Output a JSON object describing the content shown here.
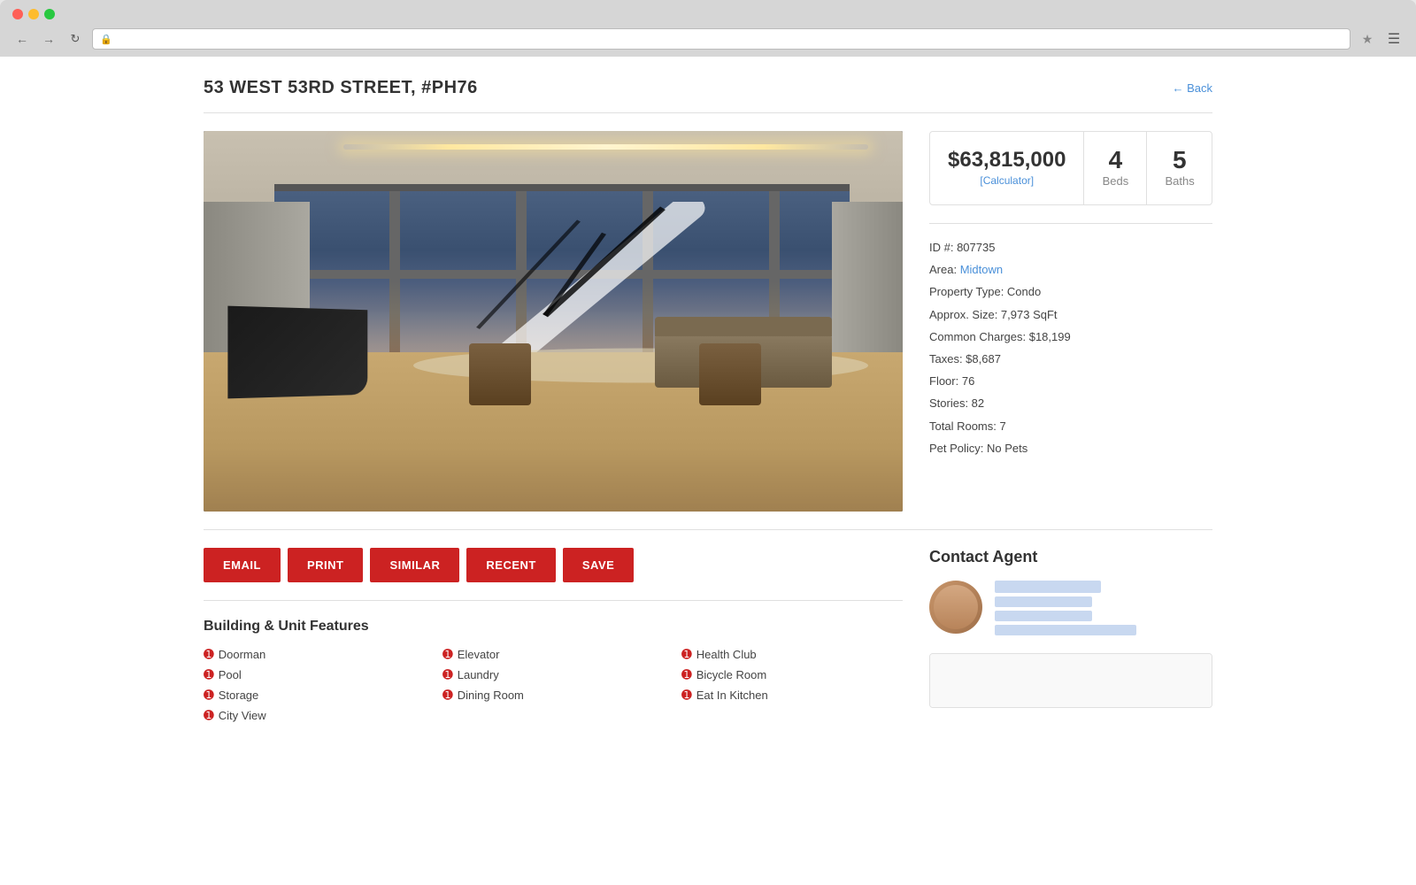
{
  "browser": {
    "address_bar_text": ""
  },
  "header": {
    "property_title": "53 WEST 53RD STREET, #PH76",
    "back_link": "← Back"
  },
  "property": {
    "price": "$63,815,000",
    "calculator_link": "[Calculator]",
    "beds": "4",
    "beds_label": "Beds",
    "baths": "5",
    "baths_label": "Baths",
    "id": "ID #: 807735",
    "area_label": "Area: ",
    "area_link": "Midtown",
    "property_type": "Property Type: Condo",
    "approx_size": "Approx. Size: 7,973 SqFt",
    "common_charges": "Common Charges: $18,199",
    "taxes": "Taxes: $8,687",
    "floor": "Floor: 76",
    "stories": "Stories: 82",
    "total_rooms": "Total Rooms: 7",
    "pet_policy": "Pet Policy: No Pets"
  },
  "action_buttons": {
    "email": "EMAIL",
    "print": "PRINT",
    "similar": "SIMILAR",
    "recent": "RECENT",
    "save": "SAVE"
  },
  "contact": {
    "section_title": "Contact Agent"
  },
  "features": {
    "section_title": "Building & Unit Features",
    "items": [
      "Doorman",
      "Elevator",
      "Health Club",
      "Pool",
      "Laundry",
      "Bicycle Room",
      "Storage",
      "Dining Room",
      "Eat In Kitchen",
      "City View"
    ]
  }
}
